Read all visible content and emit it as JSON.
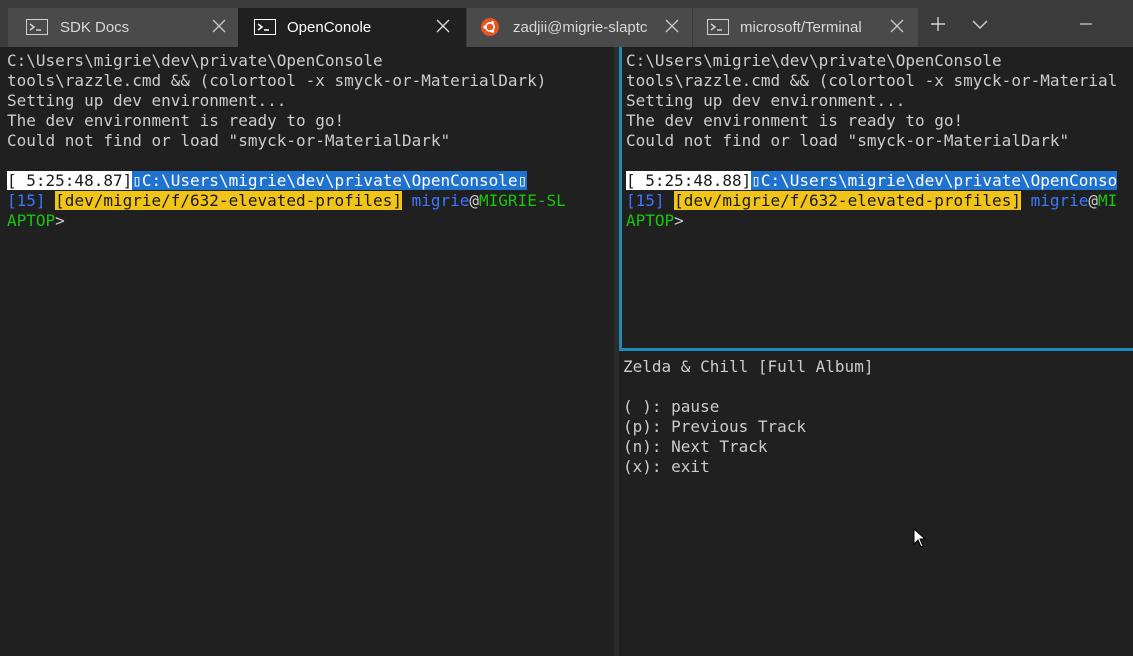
{
  "tabs": [
    {
      "label": "SDK Docs",
      "icon": "terminal-icon",
      "state": "inactive"
    },
    {
      "label": "OpenConole",
      "icon": "terminal-icon",
      "state": "active"
    },
    {
      "label": "zadjii@migrie-slaptc",
      "icon": "ubuntu-icon",
      "state": "inactive"
    },
    {
      "label": "microsoft/Terminal",
      "icon": "terminal-icon",
      "state": "inactive"
    }
  ],
  "colors": {
    "accent": "#1b8ab8",
    "path_bg": "#1f72d0",
    "branch_bg": "#f0c419",
    "user": "#3b78ff",
    "host": "#16c60c",
    "ubuntu": "#e95420"
  },
  "left_pane": {
    "line1": "C:\\Users\\migrie\\dev\\private\\OpenConsole",
    "line2": "tools\\razzle.cmd && (colortool -x smyck-or-MaterialDark)",
    "line3": "Setting up dev environment...",
    "line4": "The dev environment is ready to go!",
    "line5": "Could not find or load \"smyck-or-MaterialDark\"",
    "timestamp": "[ 5:25:48.87]",
    "path": "C:\\Users\\migrie\\dev\\private\\OpenConsole",
    "count": "[15]",
    "branch": "[dev/migrie/f/632-elevated-profiles]",
    "user": "migrie",
    "at": "@",
    "host_part1": "MIGRIE-SL",
    "host_part2": "APTOP",
    "prompt_char": ">"
  },
  "right_top_pane": {
    "line1": "C:\\Users\\migrie\\dev\\private\\OpenConsole",
    "line2": "tools\\razzle.cmd && (colortool -x smyck-or-Material",
    "line3": "Setting up dev environment...",
    "line4": "The dev environment is ready to go!",
    "line5": "Could not find or load \"smyck-or-MaterialDark\"",
    "timestamp": "[ 5:25:48.88]",
    "path": "C:\\Users\\migrie\\dev\\private\\OpenConso",
    "count": "[15]",
    "branch": "[dev/migrie/f/632-elevated-profiles]",
    "user": "migrie",
    "at": "@",
    "host_part1": "MI",
    "host_part2": "APTOP",
    "prompt_char": ">"
  },
  "right_bottom_pane": {
    "title": "Zelda & Chill [Full Album]",
    "opt1": "( ): pause",
    "opt2": "(p): Previous Track",
    "opt3": "(n): Next Track",
    "opt4": "(x): exit"
  }
}
